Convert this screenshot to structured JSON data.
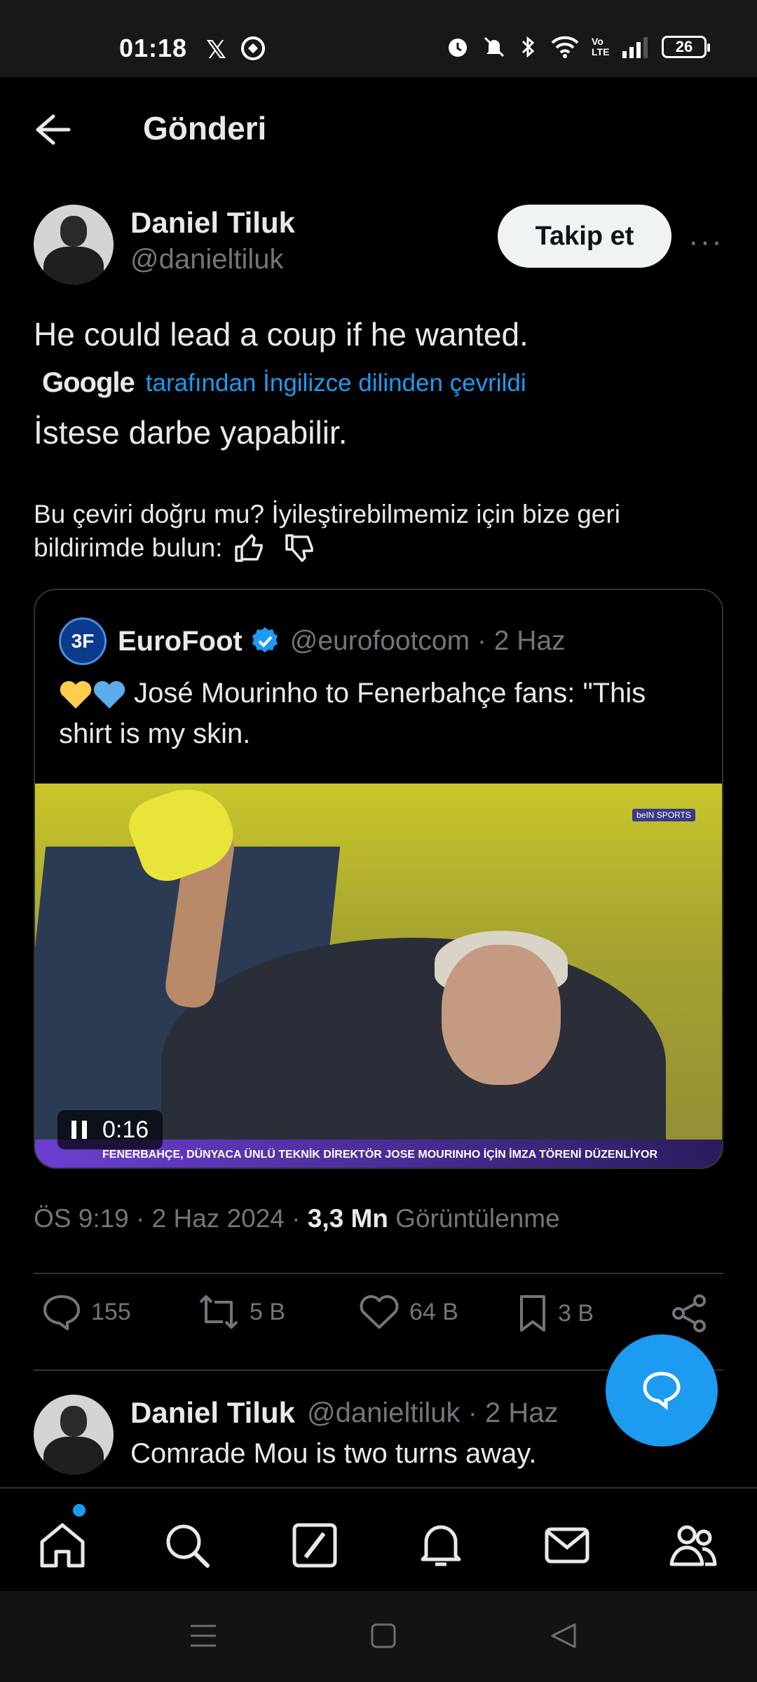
{
  "status_bar": {
    "time": "01:18",
    "app_icons": [
      "x-icon",
      "soccer-ball-icon"
    ],
    "battery": "26",
    "network": "Vo LTE"
  },
  "header": {
    "title": "Gönderi"
  },
  "author": {
    "name": "Daniel Tiluk",
    "handle": "@danieltiluk",
    "follow_label": "Takip et",
    "more_label": "···"
  },
  "tweet": {
    "text": "He could lead a coup if he wanted.",
    "translation_provider": "Google",
    "translated_by_label": "tarafından İngilizce dilinden çevrildi",
    "translation": "İstese darbe yapabilir.",
    "feedback_line1": "Bu çeviri doğru mu? İyileştirebilmemiz için bize geri",
    "feedback_line2": "bildirimde bulun:"
  },
  "quote": {
    "avatar_text": "3F",
    "name": "EuroFoot",
    "handle_date": "@eurofootcom · 2 Haz",
    "text": " José Mourinho to Fenerbahçe fans: \"This shirt is my skin.",
    "emojis": [
      "yellow-heart",
      "blue-heart"
    ],
    "video": {
      "time": "0:16",
      "ticker": "FENERBAHÇE, DÜNYACA ÜNLÜ TEKNİK DİREKTÖR JOSE MOURINHO İÇİN İMZA TÖRENİ DÜZENLİYOR",
      "channel_logo": "beIN SPORTS"
    }
  },
  "meta": {
    "time_date": "ÖS 9:19 · 2 Haz 2024 · ",
    "views_count": "3,3 Mn",
    "views_label": " Görüntülenme"
  },
  "actions": {
    "replies": "155",
    "retweets": "5 B",
    "likes": "64 B",
    "bookmarks": "3 B"
  },
  "reply": {
    "name": "Daniel Tiluk",
    "meta": "@danieltiluk · 2 Haz",
    "text": "Comrade Mou is two turns away."
  },
  "colors": {
    "accent": "#1d9bf0",
    "background": "#000000",
    "secondary_text": "#71767b"
  }
}
